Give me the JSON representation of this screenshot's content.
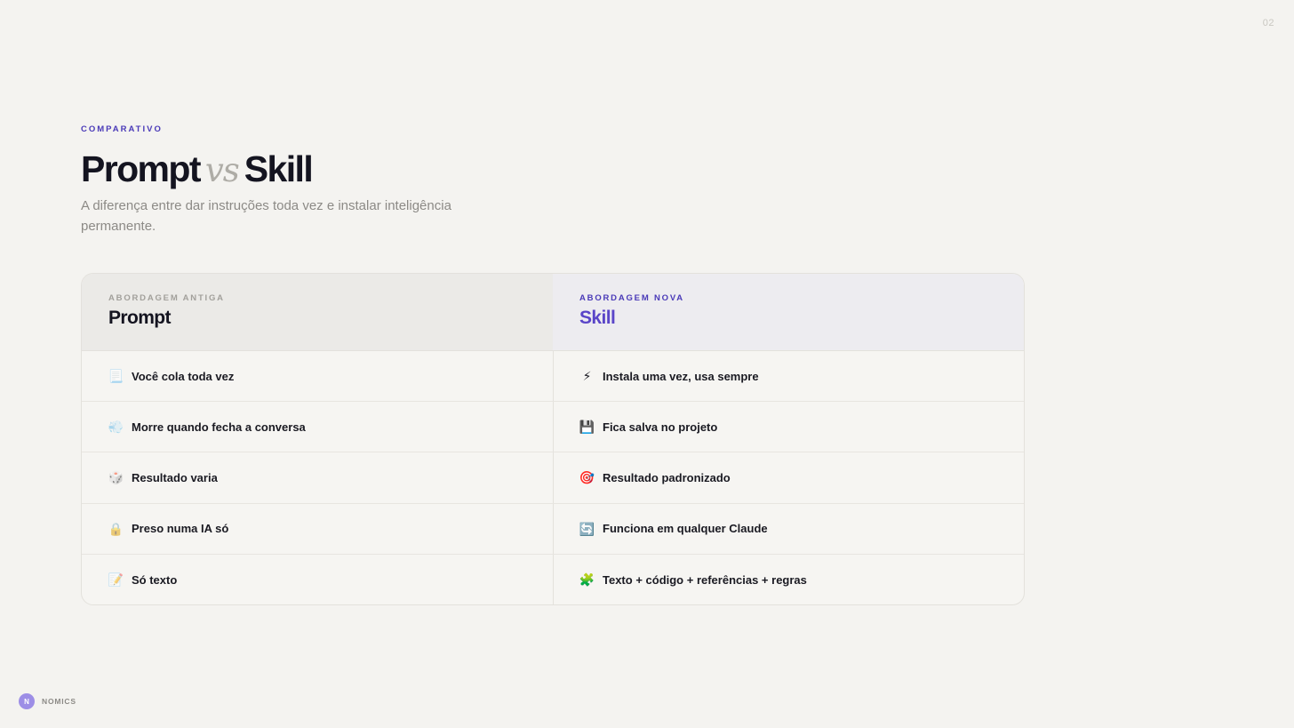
{
  "page_number": "02",
  "eyebrow": "COMPARATIVO",
  "title": {
    "left": "Prompt",
    "vs": "vs",
    "right": "Skill"
  },
  "subtitle": "A diferença entre dar instruções toda vez e instalar inteligência permanente.",
  "comparison": {
    "left": {
      "tag": "ABORDAGEM ANTIGA",
      "title": "Prompt",
      "rows": [
        {
          "icon": "📃",
          "icon_name": "page-icon",
          "text": "Você cola toda vez"
        },
        {
          "icon": "💨",
          "icon_name": "dash-away-icon",
          "text": "Morre quando fecha a conversa"
        },
        {
          "icon": "🎲",
          "icon_name": "dice-icon",
          "text": "Resultado varia"
        },
        {
          "icon": "🔒",
          "icon_name": "lock-icon",
          "text": "Preso numa IA só"
        },
        {
          "icon": "📝",
          "icon_name": "memo-icon",
          "text": "Só texto"
        }
      ]
    },
    "right": {
      "tag": "ABORDAGEM NOVA",
      "title": "Skill",
      "rows": [
        {
          "icon": "⚡",
          "icon_name": "lightning-icon",
          "text": "Instala uma vez, usa sempre"
        },
        {
          "icon": "💾",
          "icon_name": "floppy-disk-icon",
          "text": "Fica salva no projeto"
        },
        {
          "icon": "🎯",
          "icon_name": "target-icon",
          "text": "Resultado padronizado"
        },
        {
          "icon": "🔄",
          "icon_name": "refresh-icon",
          "text": "Funciona em qualquer Claude"
        },
        {
          "icon": "🧩",
          "icon_name": "puzzle-icon",
          "text": "Texto + código + referências + regras"
        }
      ]
    }
  },
  "footer": {
    "logo_letter": "N",
    "brand": "NOMICS"
  },
  "colors": {
    "accent": "#4a3ab8",
    "skill_title": "#5a45c8",
    "background": "#f4f3f0"
  }
}
